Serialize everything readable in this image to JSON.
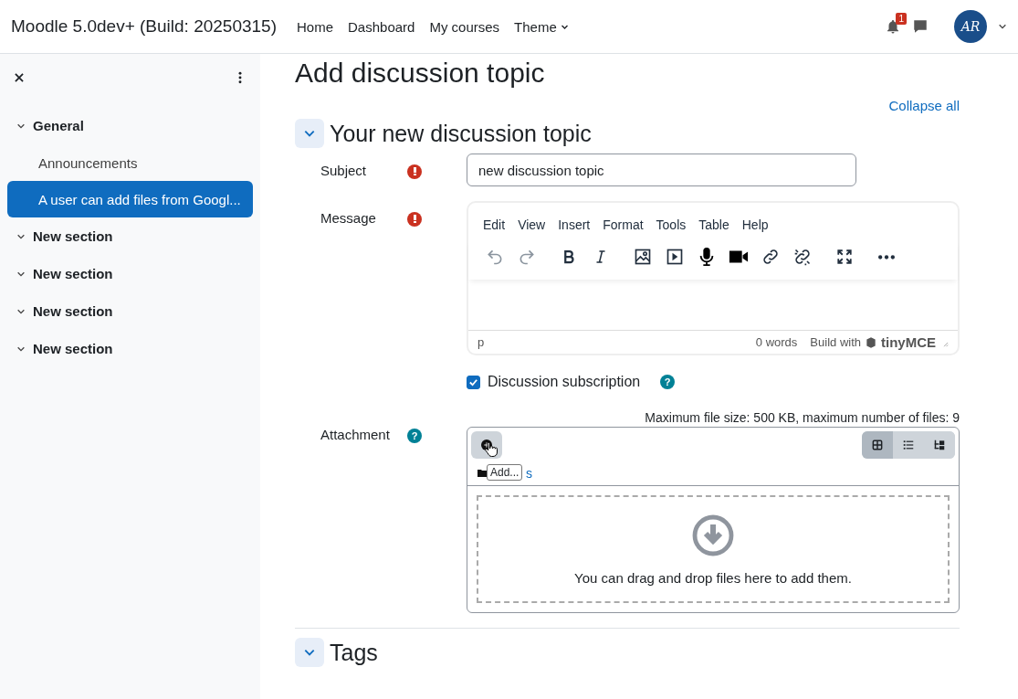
{
  "navbar": {
    "site_name": "Moodle 5.0dev+ (Build: 20250315)",
    "links": [
      {
        "label": "Home",
        "kind": "link"
      },
      {
        "label": "Dashboard",
        "kind": "link"
      },
      {
        "label": "My courses",
        "kind": "link"
      },
      {
        "label": "Theme",
        "kind": "dropdown"
      }
    ],
    "notification_count": "1",
    "avatar_initials": "AR"
  },
  "drawer": {
    "items": [
      {
        "label": "General",
        "kind": "section",
        "expanded": true,
        "selected": false
      },
      {
        "label": "Announcements",
        "kind": "activity",
        "selected": false
      },
      {
        "label": "A user can add files from Googl...",
        "kind": "activity",
        "selected": true
      },
      {
        "label": "New section",
        "kind": "section",
        "expanded": true,
        "selected": false
      },
      {
        "label": "New section",
        "kind": "section",
        "expanded": true,
        "selected": false
      },
      {
        "label": "New section",
        "kind": "section",
        "expanded": true,
        "selected": false
      },
      {
        "label": "New section",
        "kind": "section",
        "expanded": true,
        "selected": false
      }
    ]
  },
  "page": {
    "title": "Add discussion topic",
    "collapse_all": "Collapse all",
    "sections": [
      {
        "title": "Your new discussion topic",
        "expanded": true
      },
      {
        "title": "Tags",
        "expanded": true
      }
    ],
    "subject": {
      "label": "Subject",
      "value": "new discussion topic",
      "required": true
    },
    "message": {
      "label": "Message",
      "required": true,
      "menu": [
        "Edit",
        "View",
        "Insert",
        "Format",
        "Tools",
        "Table",
        "Help"
      ],
      "status_path": "p",
      "word_count": "0 words",
      "branding": "Build with",
      "branding_name": "tinyMCE"
    },
    "subscription": {
      "label": "Discussion subscription",
      "checked": true,
      "help": "?"
    },
    "attachment": {
      "label": "Attachment",
      "help": "?",
      "limits": "Maximum file size: 500 KB, maximum number of files: 9",
      "tooltip": "Add...",
      "path_link": "s",
      "drop_hint": "You can drag and drop files here to add them.",
      "views": [
        {
          "kind": "grid",
          "selected": true
        },
        {
          "kind": "list",
          "selected": false
        },
        {
          "kind": "tree",
          "selected": false
        }
      ]
    }
  }
}
